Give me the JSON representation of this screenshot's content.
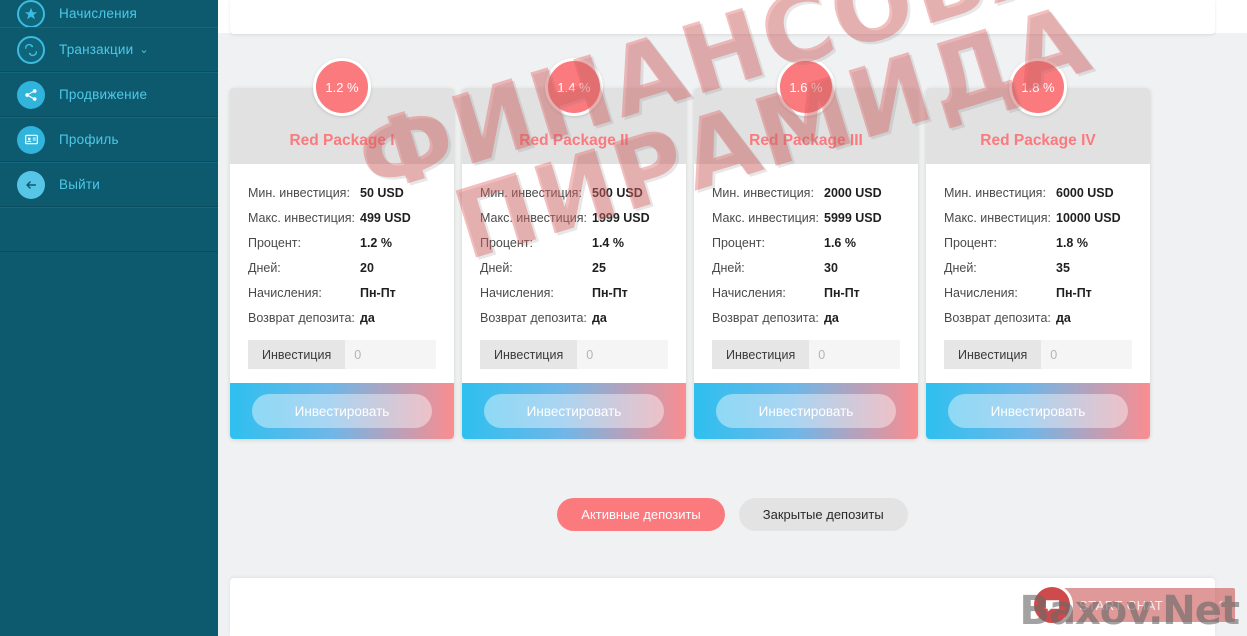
{
  "sidebar": {
    "items": [
      {
        "label": "Начисления",
        "icon": "accruals-icon",
        "chevron": "",
        "clipped": true
      },
      {
        "label": "Транзакции",
        "icon": "transactions-icon",
        "chevron": "⌄",
        "clipped": false
      },
      {
        "label": "Продвижение",
        "icon": "share-icon",
        "chevron": "",
        "clipped": false
      },
      {
        "label": "Профиль",
        "icon": "profile-card-icon",
        "chevron": "",
        "clipped": false
      },
      {
        "label": "Выйти",
        "icon": "logout-arrow-icon",
        "chevron": "",
        "clipped": false
      }
    ],
    "bg_color": "#0d5a6e",
    "label_color": "#4ec8e8"
  },
  "spec_labels": {
    "min": "Мин. инвестиция:",
    "max": "Макс. инвестиция:",
    "percent": "Процент:",
    "days": "Дней:",
    "accrual": "Начисления:",
    "refund": "Возврат депозита:"
  },
  "invest_addon_label": "Инвестиция",
  "invest_input_placeholder": "0",
  "invest_button_label": "Инвестировать",
  "packages": [
    {
      "title": "Red Package I",
      "badge": "1.2 %",
      "min": "50 USD",
      "max": "499 USD",
      "percent": "1.2 %",
      "days": "20",
      "accrual": "Пн-Пт",
      "refund": "да"
    },
    {
      "title": "Red Package II",
      "badge": "1.4 %",
      "min": "500 USD",
      "max": "1999 USD",
      "percent": "1.4 %",
      "days": "25",
      "accrual": "Пн-Пт",
      "refund": "да"
    },
    {
      "title": "Red Package III",
      "badge": "1.6 %",
      "min": "2000 USD",
      "max": "5999 USD",
      "percent": "1.6 %",
      "days": "30",
      "accrual": "Пн-Пт",
      "refund": "да"
    },
    {
      "title": "Red Package IV",
      "badge": "1.8 %",
      "min": "6000 USD",
      "max": "10000 USD",
      "percent": "1.8 %",
      "days": "35",
      "accrual": "Пн-Пт",
      "refund": "да"
    }
  ],
  "deposit_tabs": {
    "active_label": "Активные депозиты",
    "closed_label": "Закрытые депозиты",
    "active_color": "#fa7a7e",
    "idle_color": "#e3e3e3"
  },
  "watermark": {
    "line1": "ФИНАНСОВАЯ",
    "line2": "ПИРАМИДА",
    "color": "#e15c5c"
  },
  "chat": {
    "label": "START CHAT",
    "caret": "⌃",
    "icon": "chat-bubble-icon"
  },
  "site_watermark": "Baxov.Net",
  "theme": {
    "accent_pink": "#fa7a7e",
    "accent_cyan": "#2ec0ef",
    "page_bg": "#f0f1f2"
  }
}
